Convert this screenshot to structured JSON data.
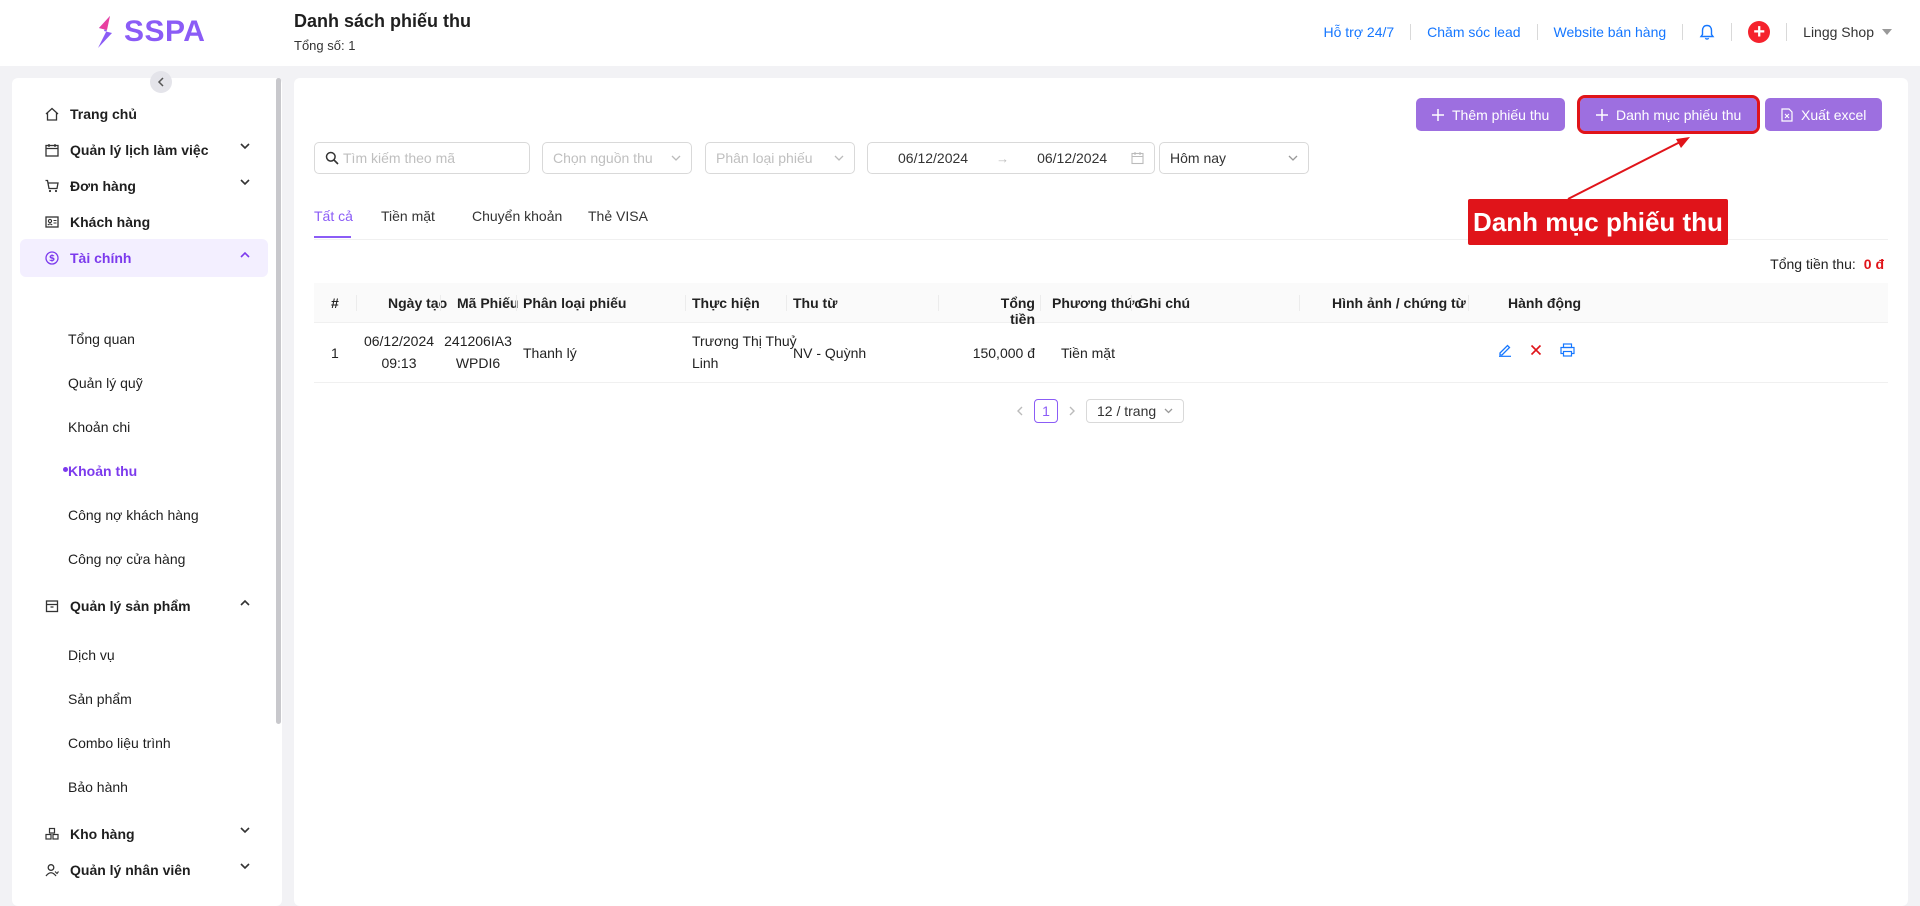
{
  "app": {
    "logo_text": "SSPA"
  },
  "header": {
    "title": "Danh sách phiếu thu",
    "subtitle": "Tổng số: 1",
    "links": [
      "Hỗ trợ 24/7",
      "Chăm sóc lead",
      "Website bán hàng"
    ],
    "shop_name": "Lingg Shop"
  },
  "sidebar": {
    "items": [
      {
        "label": "Trang chủ",
        "icon": "home-icon"
      },
      {
        "label": "Quản lý lịch làm việc",
        "icon": "calendar-icon"
      },
      {
        "label": "Đơn hàng",
        "icon": "cart-icon"
      },
      {
        "label": "Khách hàng",
        "icon": "contact-icon"
      },
      {
        "label": "Tài chính",
        "icon": "dollar-icon"
      },
      {
        "label": "Quản lý sản phẩm",
        "icon": "box-icon"
      },
      {
        "label": "Kho hàng",
        "icon": "warehouse-icon"
      },
      {
        "label": "Quản lý nhân viên",
        "icon": "staff-icon"
      }
    ],
    "finance_sub": [
      "Tổng quan",
      "Quản lý quỹ",
      "Khoản chi",
      "Khoản thu",
      "Công nợ khách hàng",
      "Công nợ cửa hàng"
    ],
    "product_sub": [
      "Dịch vụ",
      "Sản phẩm",
      "Combo liệu trình",
      "Bảo hành"
    ]
  },
  "toolbar": {
    "add_label": "Thêm phiếu thu",
    "category_label": "Danh mục phiếu thu",
    "export_label": "Xuất excel"
  },
  "filters": {
    "search_placeholder": "Tìm kiếm theo mã",
    "source_placeholder": "Chọn nguồn thu",
    "type_placeholder": "Phân loại phiếu",
    "date_from": "06/12/2024",
    "date_to": "06/12/2024",
    "range": "Hôm nay"
  },
  "tabs": [
    "Tất cả",
    "Tiền mặt",
    "Chuyển khoản",
    "Thẻ VISA"
  ],
  "summary": {
    "label": "Tổng tiền thu:",
    "amount": "0 đ"
  },
  "table": {
    "columns": [
      "#",
      "Ngày tạo",
      "Mã Phiếu",
      "Phân loại phiếu",
      "Thực hiện",
      "Thu từ",
      "Tổng tiền",
      "Phương thức",
      "Ghi chú",
      "Hình ảnh / chứng từ",
      "Hành động"
    ],
    "rows": [
      {
        "index": "1",
        "date": "06/12/2024",
        "time": "09:13",
        "code_1": "241206IA3",
        "code_2": "WPDI6",
        "type": "Thanh lý",
        "performer_1": "Trương Thị Thuỷ",
        "performer_2": "Linh",
        "from": "NV - Quỳnh",
        "total": "150,000 đ",
        "method": "Tiền mặt",
        "note": "",
        "image": ""
      }
    ]
  },
  "pagination": {
    "current": "1",
    "page_size": "12 / trang"
  },
  "annotation": {
    "label": "Danh mục phiếu thu",
    "color": "#e0141a"
  },
  "colors": {
    "accent": "#8b5cf6",
    "button": "#9d6fe0",
    "link": "#1677ff",
    "danger": "#e0141a"
  }
}
